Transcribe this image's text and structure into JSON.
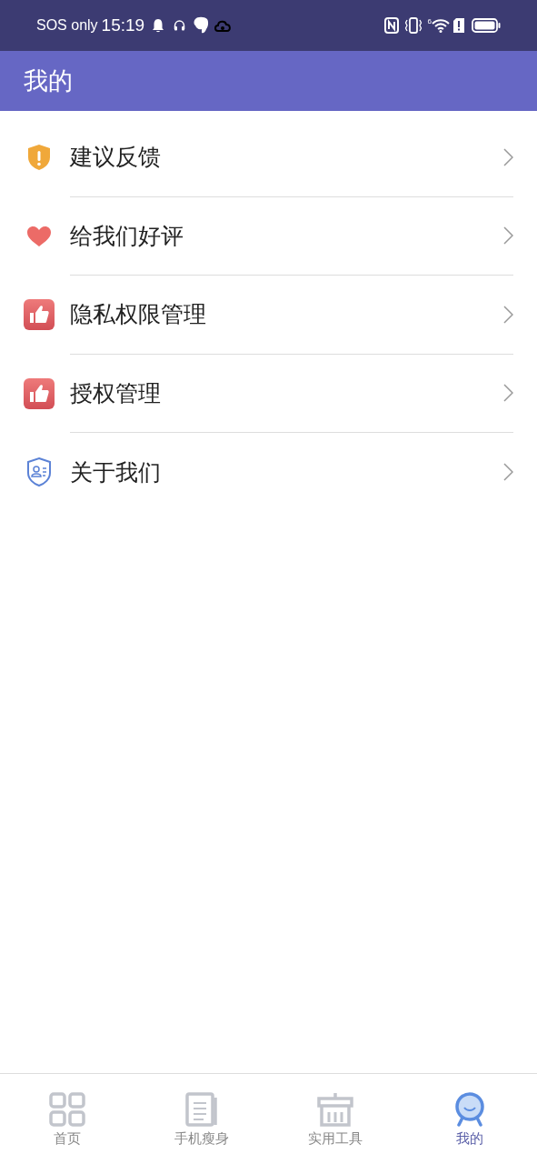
{
  "status_bar": {
    "carrier": "SOS only",
    "time": "15:19",
    "wifi_badge": "6"
  },
  "header": {
    "title": "我的"
  },
  "menu": [
    {
      "kind": "shield",
      "label": "建议反馈"
    },
    {
      "kind": "heart",
      "label": "给我们好评"
    },
    {
      "kind": "thumb",
      "label": "隐私权限管理"
    },
    {
      "kind": "thumb",
      "label": "授权管理"
    },
    {
      "kind": "badge",
      "label": "关于我们"
    }
  ],
  "tabs": [
    {
      "kind": "grid",
      "label": "首页",
      "selected": false
    },
    {
      "kind": "doc",
      "label": "手机瘦身",
      "selected": false
    },
    {
      "kind": "basket",
      "label": "实用工具",
      "selected": false
    },
    {
      "kind": "face",
      "label": "我的",
      "selected": true
    }
  ]
}
